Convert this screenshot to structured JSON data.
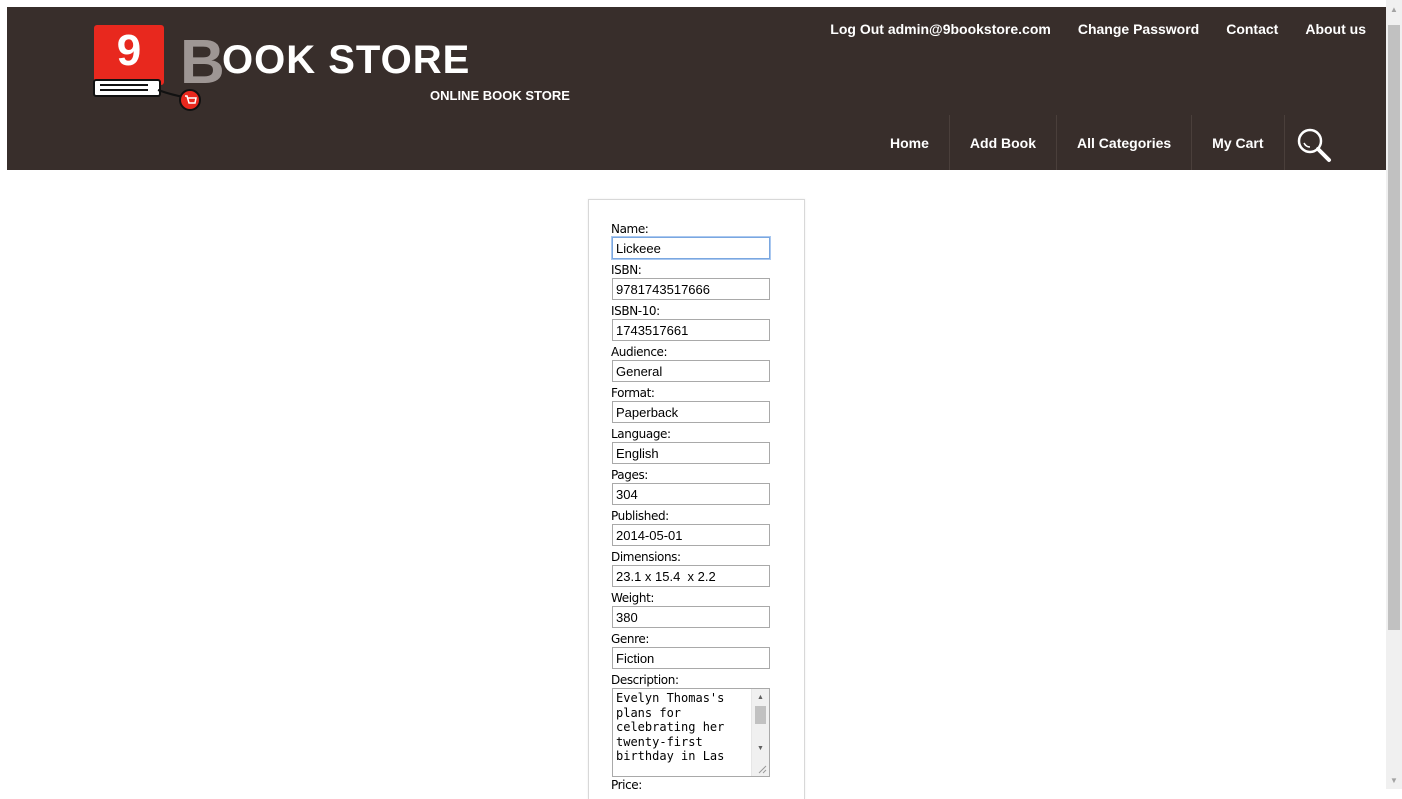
{
  "brand": {
    "logo_number": "9",
    "logo_letter": "B",
    "logo_word": "OOK STORE",
    "tagline": "ONLINE BOOK STORE"
  },
  "top_nav": [
    {
      "label": "Log Out admin@9bookstore.com"
    },
    {
      "label": "Change Password"
    },
    {
      "label": "Contact"
    },
    {
      "label": "About us"
    }
  ],
  "main_nav": [
    {
      "label": "Home"
    },
    {
      "label": "Add Book"
    },
    {
      "label": "All Categories"
    },
    {
      "label": "My Cart"
    }
  ],
  "search": {
    "icon": "search-icon"
  },
  "form": {
    "fields": [
      {
        "label": "Name:",
        "value": "Lickeee"
      },
      {
        "label": "ISBN:",
        "value": "9781743517666"
      },
      {
        "label": "ISBN-10:",
        "value": "1743517661"
      },
      {
        "label": "Audience:",
        "value": "General"
      },
      {
        "label": "Format:",
        "value": "Paperback"
      },
      {
        "label": "Language:",
        "value": "English"
      },
      {
        "label": "Pages:",
        "value": "304"
      },
      {
        "label": "Published:",
        "value": "2014-05-01"
      },
      {
        "label": "Dimensions:",
        "value": "23.1 x 15.4  x 2.2"
      },
      {
        "label": "Weight:",
        "value": "380"
      },
      {
        "label": "Genre:",
        "value": "Fiction"
      }
    ],
    "description_label": "Description:",
    "description_value": "Evelyn Thomas's plans for celebrating her twenty-first birthday in Las",
    "price_label": "Price:"
  },
  "colors": {
    "header_bg": "#382e2b",
    "logo_red": "#e8281e",
    "logo_gray": "#9e9694"
  }
}
